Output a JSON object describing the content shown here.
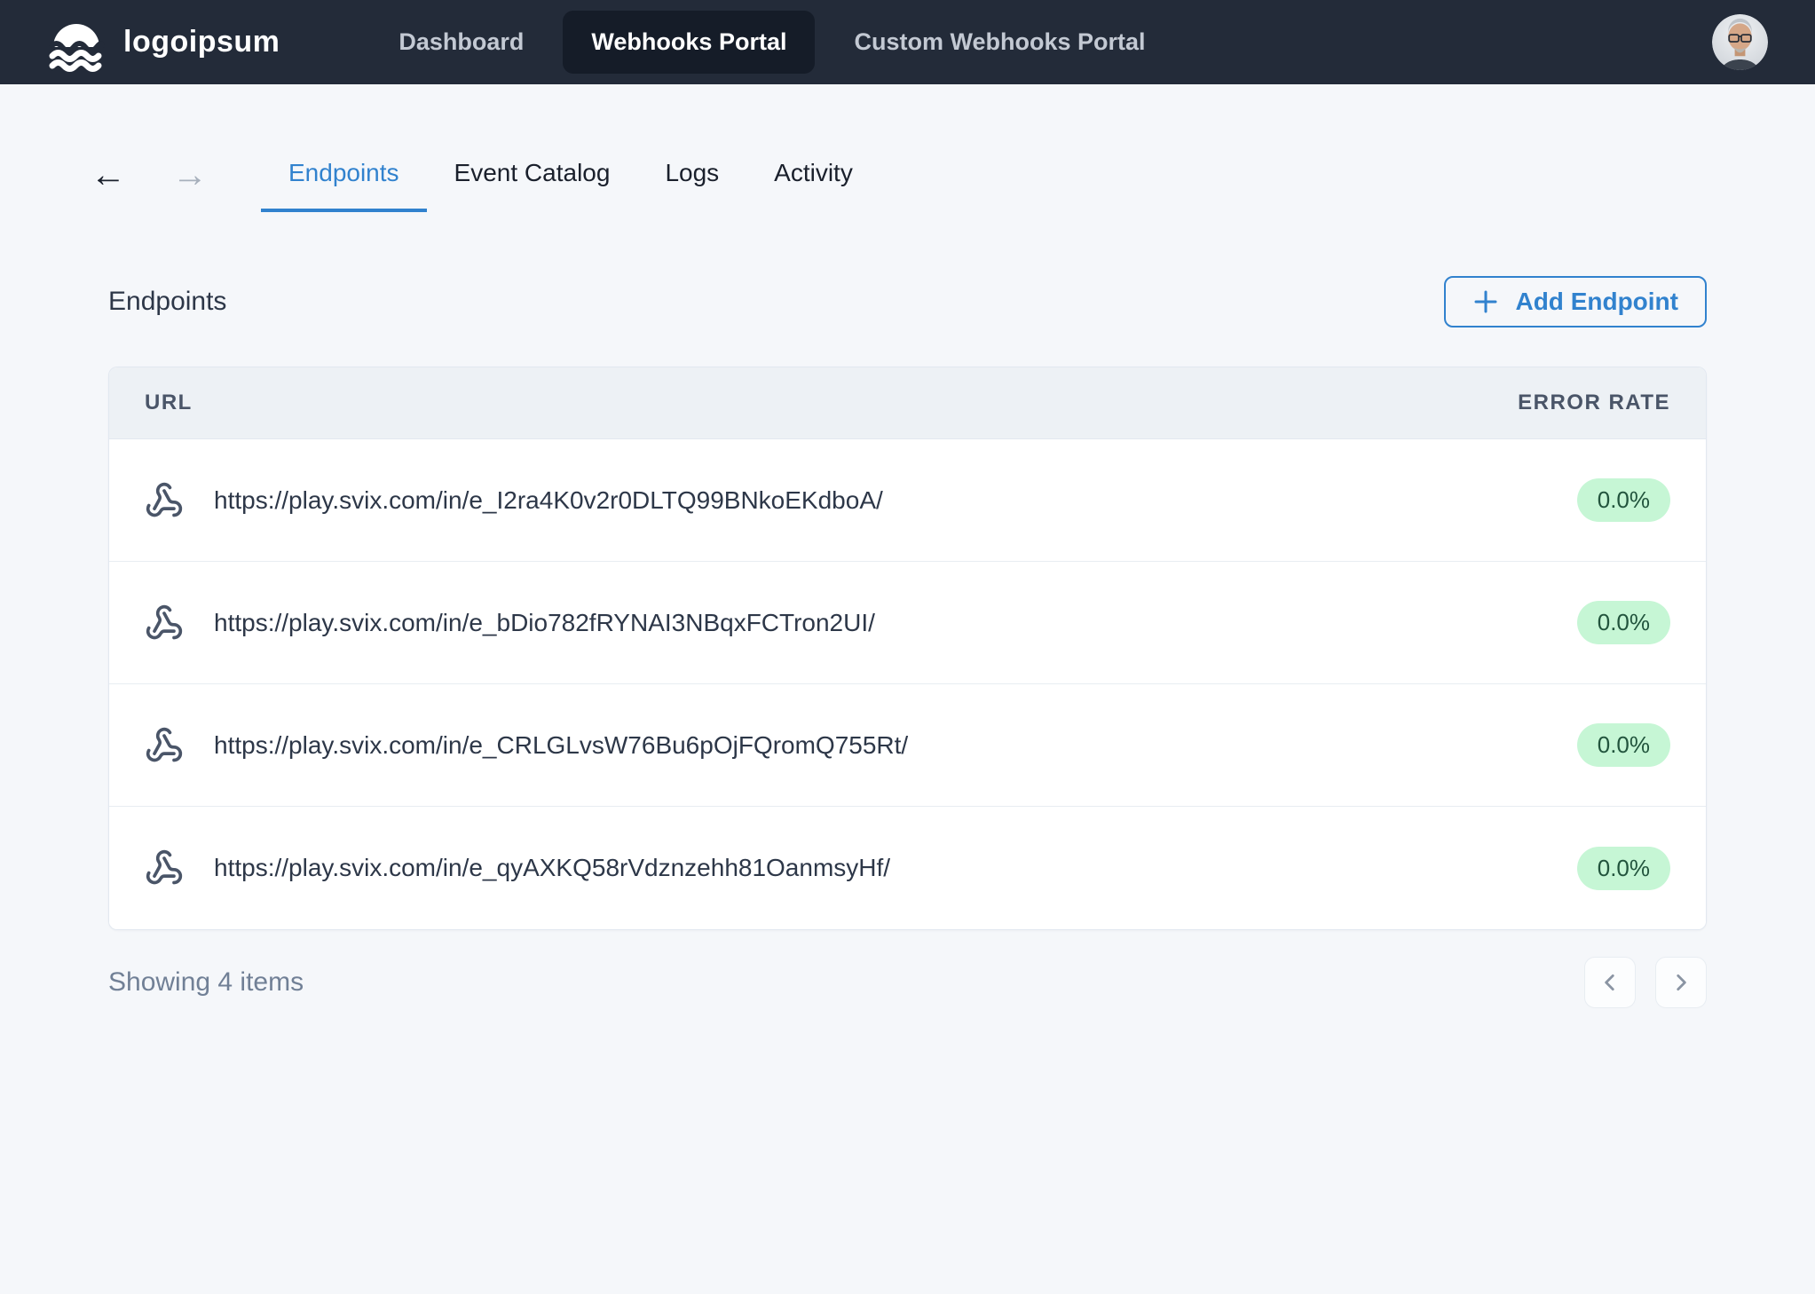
{
  "navbar": {
    "brand": "logoipsum",
    "links": [
      {
        "label": "Dashboard",
        "active": false
      },
      {
        "label": "Webhooks Portal",
        "active": true
      },
      {
        "label": "Custom Webhooks Portal",
        "active": false
      }
    ]
  },
  "tabs": {
    "items": [
      {
        "label": "Endpoints",
        "active": true
      },
      {
        "label": "Event Catalog",
        "active": false
      },
      {
        "label": "Logs",
        "active": false
      },
      {
        "label": "Activity",
        "active": false
      }
    ]
  },
  "page": {
    "title": "Endpoints",
    "add_button_label": "Add Endpoint"
  },
  "table": {
    "columns": [
      "URL",
      "ERROR RATE"
    ],
    "rows": [
      {
        "url": "https://play.svix.com/in/e_I2ra4K0v2r0DLTQ99BNkoEKdboA/",
        "error_rate": "0.0%"
      },
      {
        "url": "https://play.svix.com/in/e_bDio782fRYNAI3NBqxFCTron2UI/",
        "error_rate": "0.0%"
      },
      {
        "url": "https://play.svix.com/in/e_CRLGLvsW76Bu6pOjFQromQ755Rt/",
        "error_rate": "0.0%"
      },
      {
        "url": "https://play.svix.com/in/e_qyAXKQ58rVdznzehh81OanmsyHf/",
        "error_rate": "0.0%"
      }
    ]
  },
  "footer": {
    "showing_text": "Showing 4 items"
  },
  "icons": {
    "brand_logo": "sun-waves-logo",
    "row": "webhook-icon",
    "add": "plus-icon",
    "back": "arrow-left-icon",
    "forward": "arrow-right-icon",
    "prev": "chevron-left-icon",
    "next": "chevron-right-icon"
  },
  "colors": {
    "accent_blue": "#3182CE",
    "navbar_bg": "#232B39",
    "navbar_active_bg": "#151C28",
    "page_bg": "#F5F7FA",
    "table_header_bg": "#EDF1F5",
    "badge_green_bg": "#C6F6D5",
    "badge_green_text": "#22543D",
    "muted_text": "#718096"
  }
}
